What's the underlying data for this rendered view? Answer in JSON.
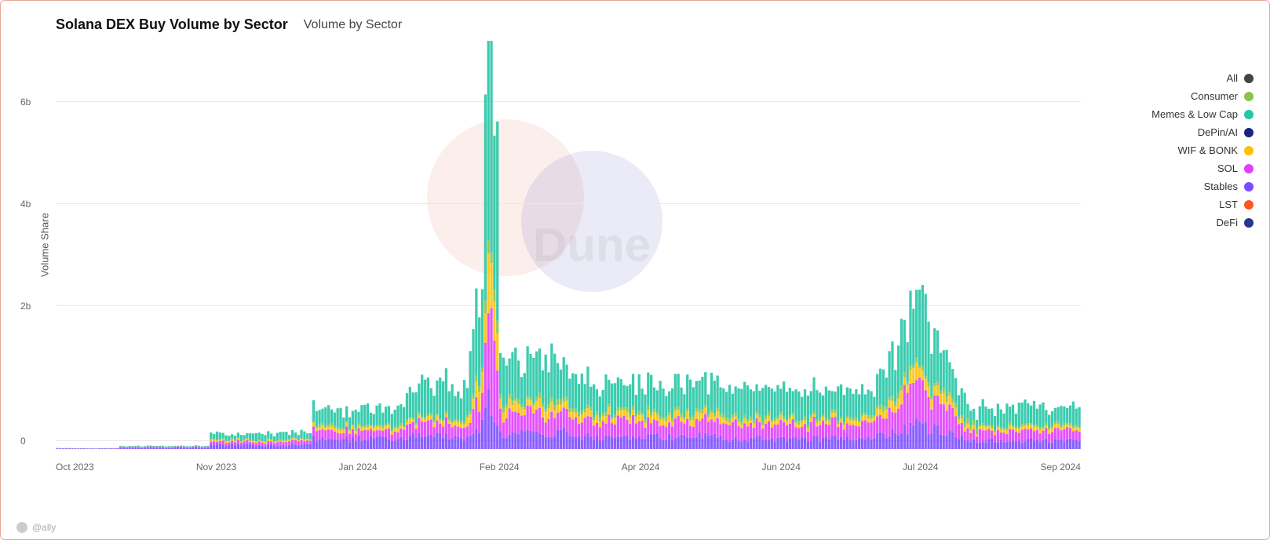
{
  "header": {
    "main_title": "Solana DEX Buy Volume by Sector",
    "sub_title": "Volume by Sector"
  },
  "y_axis": {
    "label": "Volume Share",
    "ticks": [
      {
        "label": "6b",
        "pct": 0.85
      },
      {
        "label": "4b",
        "pct": 0.6
      },
      {
        "label": "2b",
        "pct": 0.35
      },
      {
        "label": "0",
        "pct": 0.02
      }
    ]
  },
  "x_axis": {
    "labels": [
      "Oct 2023",
      "Nov 2023",
      "Jan 2024",
      "Feb 2024",
      "Apr 2024",
      "Jun 2024",
      "Jul 2024",
      "Sep 2024"
    ]
  },
  "legend": {
    "items": [
      {
        "label": "All",
        "color": "#444444"
      },
      {
        "label": "Consumer",
        "color": "#8bc34a"
      },
      {
        "label": "Memes & Low Cap",
        "color": "#26c6a6"
      },
      {
        "label": "DePin/AI",
        "color": "#1a237e"
      },
      {
        "label": "WIF & BONK",
        "color": "#ffc107"
      },
      {
        "label": "SOL",
        "color": "#e040fb"
      },
      {
        "label": "Stables",
        "color": "#7c4dff"
      },
      {
        "label": "LST",
        "color": "#ff5722"
      },
      {
        "label": "DeFi",
        "color": "#283593"
      }
    ]
  },
  "watermark": "Dune",
  "attribution": "@ally"
}
